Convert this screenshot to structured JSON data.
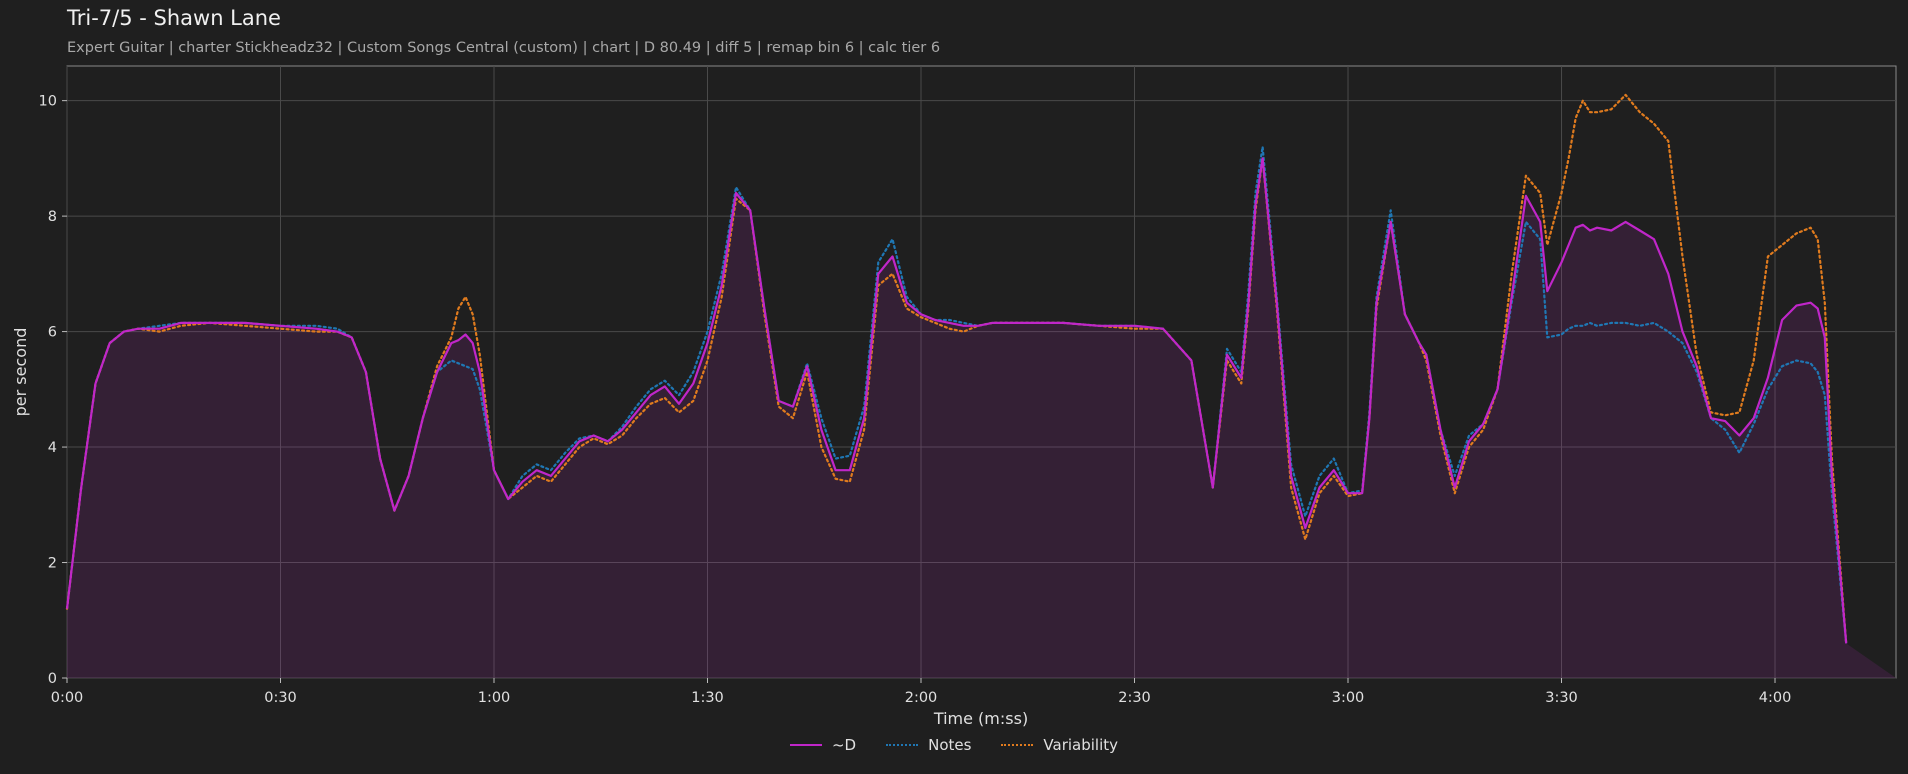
{
  "title": "Tri-7/5 - Shawn Lane",
  "subtitle": "Expert Guitar  |  charter Stickheadz32  |  Custom Songs Central (custom)  |  chart  |  D 80.49  |  diff 5  |  remap bin 6  |  calc tier 6",
  "chart_data": {
    "type": "line",
    "xlabel": "Time (m:ss)",
    "ylabel": "per second",
    "xlim": [
      0,
      257
    ],
    "ylim": [
      0,
      10.6
    ],
    "x_ticks": [
      0,
      30,
      60,
      90,
      120,
      150,
      180,
      210,
      240
    ],
    "x_tick_labels": [
      "0:00",
      "0:30",
      "1:00",
      "1:30",
      "2:00",
      "2:30",
      "3:00",
      "3:30",
      "4:00"
    ],
    "y_ticks": [
      0,
      2,
      4,
      6,
      8,
      10
    ],
    "y_tick_labels": [
      "0",
      "2",
      "4",
      "6",
      "8",
      "10"
    ],
    "grid": true,
    "legend_position": "bottom-center",
    "x": [
      0,
      2,
      4,
      6,
      8,
      10,
      13,
      16,
      20,
      25,
      30,
      35,
      38,
      40,
      42,
      44,
      46,
      48,
      50,
      52,
      54,
      55,
      56,
      57,
      58,
      60,
      62,
      64,
      66,
      68,
      70,
      72,
      74,
      76,
      78,
      80,
      82,
      84,
      86,
      88,
      90,
      92,
      94,
      96,
      98,
      100,
      102,
      104,
      106,
      108,
      110,
      112,
      114,
      116,
      118,
      120,
      122,
      124,
      126,
      128,
      130,
      135,
      140,
      145,
      150,
      154,
      158,
      161,
      163,
      165,
      166,
      167,
      168,
      170,
      172,
      174,
      176,
      178,
      180,
      182,
      183,
      184,
      186,
      188,
      190,
      191,
      193,
      195,
      197,
      199,
      201,
      203,
      205,
      207,
      208,
      210,
      211,
      212,
      213,
      214,
      215,
      217,
      219,
      221,
      223,
      225,
      227,
      229,
      231,
      233,
      235,
      237,
      239,
      241,
      243,
      245,
      246,
      247,
      248,
      250,
      252,
      254,
      255,
      256,
      257
    ],
    "series": [
      {
        "name": "~D",
        "color": "#c026c9",
        "style": "solid",
        "values": [
          1.2,
          3.3,
          5.1,
          5.8,
          6.0,
          6.05,
          6.05,
          6.15,
          6.15,
          6.15,
          6.1,
          6.05,
          6.0,
          5.9,
          5.3,
          3.8,
          2.9,
          3.5,
          4.5,
          5.3,
          5.8,
          5.85,
          5.95,
          5.8,
          5.3,
          3.6,
          3.1,
          3.4,
          3.6,
          3.5,
          3.8,
          4.1,
          4.2,
          4.1,
          4.3,
          4.6,
          4.9,
          5.05,
          4.75,
          5.1,
          5.8,
          6.8,
          8.4,
          8.1,
          6.4,
          4.8,
          4.7,
          5.4,
          4.3,
          3.6,
          3.6,
          4.5,
          7.0,
          7.3,
          6.5,
          6.3,
          6.2,
          6.15,
          6.1,
          6.1,
          6.15,
          6.15,
          6.15,
          6.1,
          6.1,
          6.05,
          5.5,
          3.3,
          5.6,
          5.2,
          6.5,
          8.2,
          9.0,
          6.5,
          3.5,
          2.6,
          3.3,
          3.6,
          3.2,
          3.2,
          4.5,
          6.5,
          7.9,
          6.3,
          5.8,
          5.6,
          4.3,
          3.3,
          4.1,
          4.4,
          5.0,
          6.6,
          8.35,
          7.9,
          6.7,
          7.2,
          7.5,
          7.8,
          7.85,
          7.75,
          7.8,
          7.75,
          7.9,
          7.75,
          7.6,
          7.0,
          6.0,
          5.4,
          4.5,
          4.45,
          4.2,
          4.5,
          5.2,
          6.2,
          6.45,
          6.5,
          6.4,
          5.9,
          3.5,
          0.6
        ]
      },
      {
        "name": "Notes",
        "color": "#1f77b4",
        "style": "dotted",
        "values": [
          1.2,
          3.3,
          5.1,
          5.8,
          6.0,
          6.05,
          6.1,
          6.15,
          6.15,
          6.15,
          6.1,
          6.1,
          6.05,
          5.9,
          5.3,
          3.8,
          2.9,
          3.5,
          4.5,
          5.3,
          5.5,
          5.45,
          5.4,
          5.35,
          5.0,
          3.6,
          3.1,
          3.5,
          3.7,
          3.6,
          3.9,
          4.15,
          4.2,
          4.1,
          4.35,
          4.7,
          5.0,
          5.15,
          4.9,
          5.3,
          6.0,
          7.0,
          8.5,
          8.1,
          6.4,
          4.8,
          4.7,
          5.45,
          4.5,
          3.8,
          3.85,
          4.7,
          7.2,
          7.6,
          6.6,
          6.3,
          6.2,
          6.2,
          6.15,
          6.1,
          6.15,
          6.15,
          6.15,
          6.1,
          6.1,
          6.05,
          5.5,
          3.3,
          5.7,
          5.3,
          6.7,
          8.4,
          9.2,
          6.6,
          3.7,
          2.8,
          3.5,
          3.8,
          3.2,
          3.25,
          4.6,
          6.6,
          8.1,
          6.3,
          5.8,
          5.6,
          4.3,
          3.5,
          4.2,
          4.4,
          5.0,
          6.5,
          7.9,
          7.6,
          5.9,
          5.95,
          6.05,
          6.1,
          6.1,
          6.15,
          6.1,
          6.15,
          6.15,
          6.1,
          6.15,
          6.0,
          5.8,
          5.3,
          4.5,
          4.3,
          3.9,
          4.4,
          5.0,
          5.4,
          5.5,
          5.45,
          5.3,
          4.9,
          3.2,
          0.6
        ]
      },
      {
        "name": "Variability",
        "color": "#e07b1e",
        "style": "dotted",
        "values": [
          1.2,
          3.3,
          5.1,
          5.8,
          6.0,
          6.05,
          6.0,
          6.1,
          6.15,
          6.1,
          6.05,
          6.0,
          6.0,
          5.9,
          5.3,
          3.8,
          2.9,
          3.5,
          4.5,
          5.4,
          5.9,
          6.4,
          6.6,
          6.3,
          5.6,
          3.6,
          3.1,
          3.3,
          3.5,
          3.4,
          3.7,
          4.0,
          4.15,
          4.05,
          4.2,
          4.5,
          4.75,
          4.85,
          4.6,
          4.8,
          5.5,
          6.6,
          8.3,
          8.1,
          6.3,
          4.7,
          4.5,
          5.3,
          4.0,
          3.45,
          3.4,
          4.3,
          6.8,
          7.0,
          6.4,
          6.25,
          6.15,
          6.05,
          6.0,
          6.1,
          6.15,
          6.15,
          6.15,
          6.1,
          6.05,
          6.05,
          5.5,
          3.3,
          5.5,
          5.1,
          6.4,
          8.1,
          9.0,
          6.4,
          3.3,
          2.4,
          3.2,
          3.5,
          3.15,
          3.2,
          4.5,
          6.4,
          7.9,
          6.3,
          5.8,
          5.5,
          4.2,
          3.2,
          4.0,
          4.3,
          5.0,
          7.0,
          8.7,
          8.4,
          7.5,
          8.4,
          9.0,
          9.7,
          10.0,
          9.8,
          9.8,
          9.85,
          10.1,
          9.8,
          9.6,
          9.3,
          7.3,
          5.6,
          4.6,
          4.55,
          4.6,
          5.5,
          7.3,
          7.5,
          7.7,
          7.8,
          7.6,
          6.5,
          3.8,
          0.6
        ]
      }
    ]
  }
}
